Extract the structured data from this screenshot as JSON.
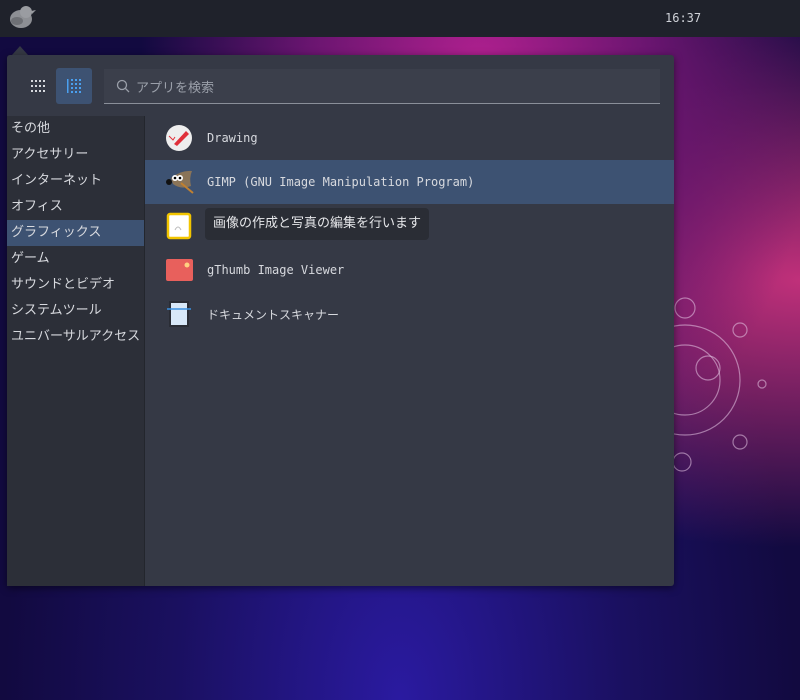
{
  "topbar": {
    "clock": "16:37"
  },
  "search": {
    "placeholder": "アプリを検索"
  },
  "categories": [
    "その他",
    "アクセサリー",
    "インターネット",
    "オフィス",
    "グラフィックス",
    "ゲーム",
    "サウンドとビデオ",
    "システムツール",
    "ユニバーサルアクセス"
  ],
  "selected_category": "グラフィックス",
  "apps": [
    {
      "label": "Drawing",
      "icon": "drawing-icon"
    },
    {
      "label": "GIMP (GNU Image Manipulation Program)",
      "icon": "gimp-icon"
    },
    {
      "label": "",
      "icon": "libreoffice-draw-icon"
    },
    {
      "label": "gThumb Image Viewer",
      "icon": "gthumb-icon"
    },
    {
      "label": "ドキュメントスキャナー",
      "icon": "scanner-icon"
    }
  ],
  "tooltip": "画像の作成と写真の編集を行います",
  "colors": {
    "accent": "#3d5272",
    "panel": "#353945"
  }
}
